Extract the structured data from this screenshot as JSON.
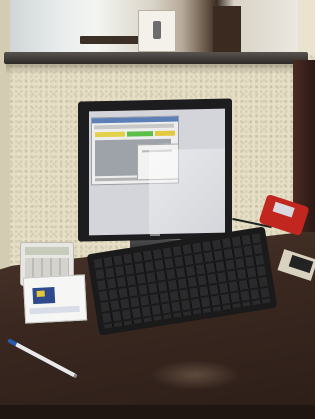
{
  "scene": {
    "colors": {
      "wall": "#e6dfc6",
      "desk": "#3a2820",
      "monitor": "#1d1d1f",
      "terminal": "#c2271f"
    },
    "objects": [
      "window-opening",
      "stucco-wall",
      "counter-ledge",
      "monitor",
      "keyboard",
      "calculator",
      "card-stack",
      "pen",
      "card-terminal",
      "desk"
    ]
  }
}
